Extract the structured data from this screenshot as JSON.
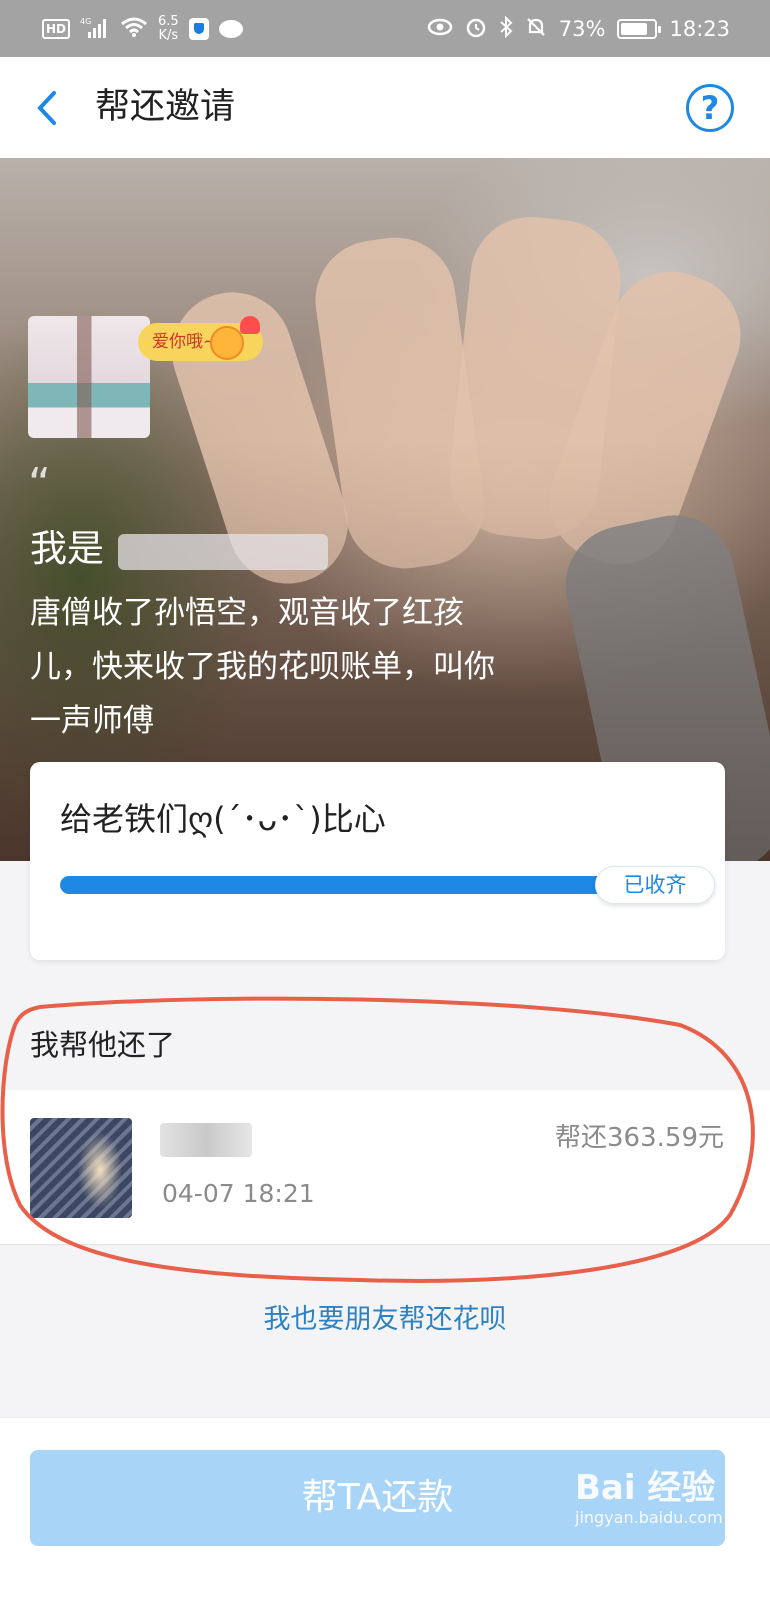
{
  "status_bar": {
    "hd": "HD",
    "net": "4G",
    "speed_value": "6.5",
    "speed_unit": "K/s",
    "battery": "73%",
    "time": "18:23",
    "icons": [
      "signal-icon",
      "wifi-icon",
      "shield-app-icon",
      "chat-app-icon",
      "eye-icon",
      "alarm-icon",
      "bluetooth-icon",
      "mute-icon",
      "battery-icon"
    ]
  },
  "nav": {
    "title": "帮还邀请",
    "back_icon": "chevron-left-icon",
    "help_glyph": "?"
  },
  "hero": {
    "tag": "爱你哦~",
    "quote_glyph": "“",
    "name_prefix": "我是",
    "message": "唐僧收了孙悟空，观音收了红孩儿，快来收了我的花呗账单，叫你一声师傅"
  },
  "progress_card": {
    "title": "给老铁们ღ(´･ᴗ･`)比心",
    "status": "已收齐",
    "progress": 1.0
  },
  "helpers": {
    "section_title": "我帮他还了",
    "items": [
      {
        "time": "04-07 18:21",
        "amount": "帮还363.59元"
      }
    ]
  },
  "footer": {
    "link_text": "我也要朋友帮还花呗",
    "button_label": "帮TA还款",
    "watermark_main": "Bai 经验",
    "watermark_sub": "jingyan.baidu.com"
  },
  "colors": {
    "accent": "#1e88e5",
    "button_disabled": "#a8d4f8",
    "annotation": "#e8604a"
  }
}
